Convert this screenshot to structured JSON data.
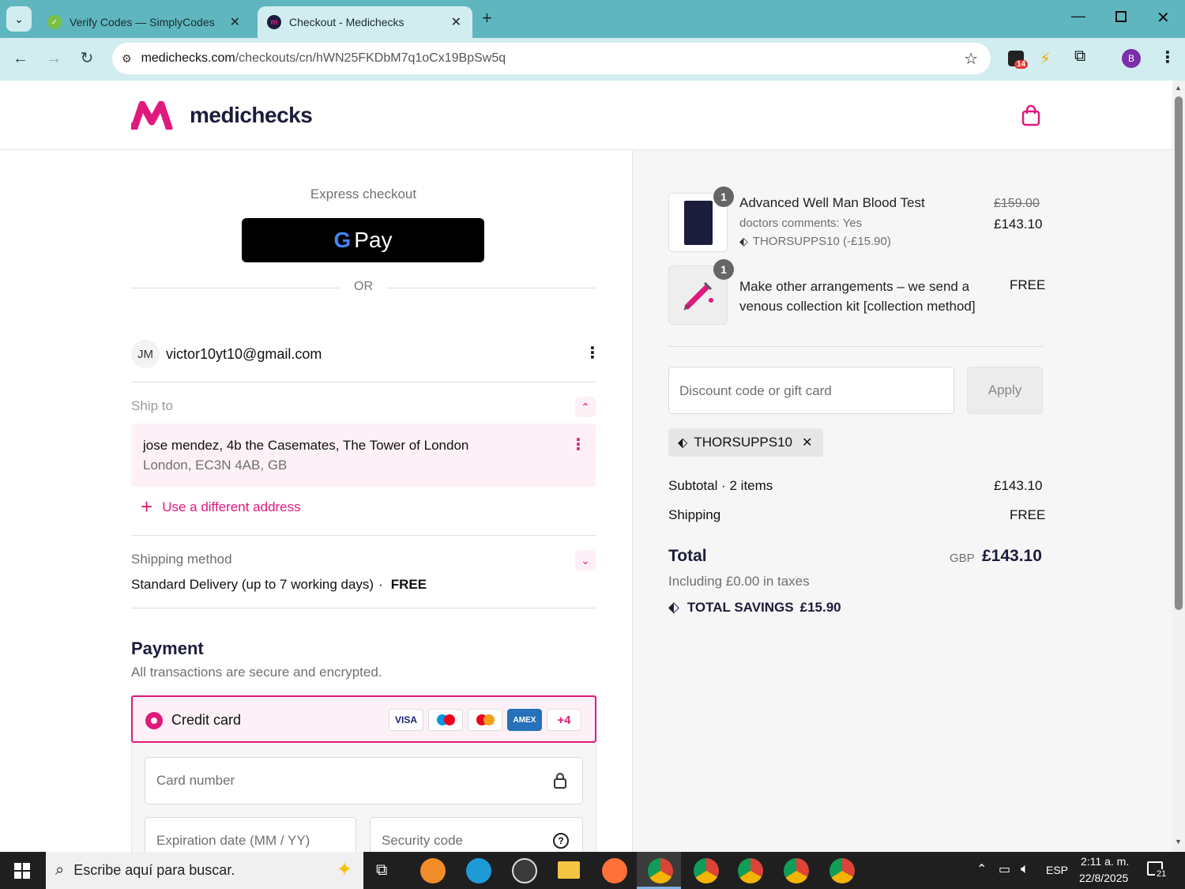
{
  "browser": {
    "tabs": [
      {
        "title": "Verify Codes — SimplyCodes",
        "active": false
      },
      {
        "title": "Checkout - Medichecks",
        "active": true
      }
    ],
    "url_domain": "medichecks.com",
    "url_path": "/checkouts/cn/hWN25FKDbM7q1oCx19BpSw5q",
    "ext_badge": "14",
    "profile_initial": "B"
  },
  "header": {
    "brand": "medichecks"
  },
  "express": {
    "label": "Express checkout",
    "gpay_label": "Pay",
    "or": "OR"
  },
  "account": {
    "initials": "JM",
    "email": "victor10yt10@gmail.com"
  },
  "ship_to": {
    "label": "Ship to",
    "line1": "jose mendez, 4b the Casemates, The Tower of London",
    "line2": "London, EC3N 4AB, GB",
    "different_address": "Use a different address"
  },
  "shipping_method": {
    "label": "Shipping method",
    "value": "Standard Delivery (up to 7 working days)",
    "separator": "·",
    "price": "FREE"
  },
  "payment": {
    "title": "Payment",
    "subtitle": "All transactions are secure and encrypted.",
    "method": "Credit card",
    "logos": [
      "VISA",
      "maestro",
      "mastercard",
      "AMEX"
    ],
    "more": "+4",
    "card_number_placeholder": "Card number",
    "expiry_placeholder": "Expiration date (MM / YY)",
    "security_placeholder": "Security code"
  },
  "order": {
    "items": [
      {
        "qty": "1",
        "name": "Advanced Well Man Blood Test",
        "meta": "doctors comments: Yes",
        "discount": "THORSUPPS10 (-£15.90)",
        "old_price": "£159.00",
        "price": "£143.10"
      },
      {
        "qty": "1",
        "name": "Make other arrangements – we send a venous collection kit [collection method]",
        "price": "FREE"
      }
    ],
    "discount_placeholder": "Discount code or gift card",
    "apply_label": "Apply",
    "applied_code": "THORSUPPS10",
    "subtotal_label": "Subtotal · 2 items",
    "subtotal": "£143.10",
    "shipping_label": "Shipping",
    "shipping": "FREE",
    "total_label": "Total",
    "currency": "GBP",
    "total": "£143.10",
    "taxes": "Including £0.00 in taxes",
    "savings_label": "TOTAL SAVINGS",
    "savings": "£15.90"
  },
  "taskbar": {
    "search_placeholder": "Escribe aquí para buscar.",
    "lang": "ESP",
    "time": "2:11 a. m.",
    "date": "22/8/2025",
    "notif_count": "21"
  },
  "colors": {
    "accent": "#e0197d",
    "brand_dark": "#1c1c3c",
    "browser_frame": "#5fb6bf"
  }
}
